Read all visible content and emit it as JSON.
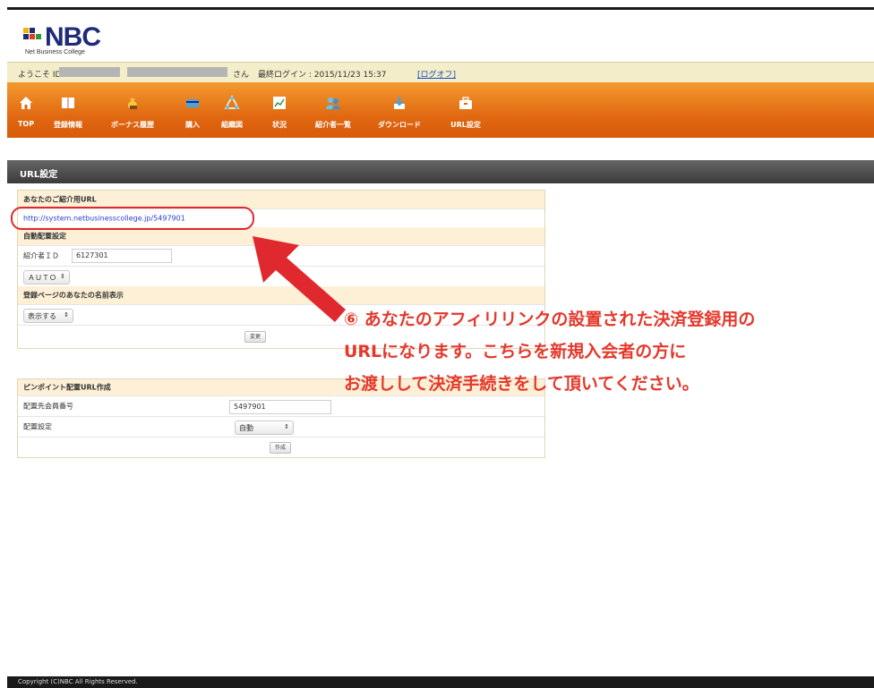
{
  "brand": {
    "logo_text": "NBC",
    "tagline": "Net Business College"
  },
  "welcome": {
    "greeting": "ようこそ ID",
    "honorific": "さん",
    "last_login_label": "最終ログイン : 2015/11/23 15:37",
    "logout_label": "[ログオフ]"
  },
  "nav": {
    "items": [
      {
        "label": "TOP",
        "icon": "home-icon"
      },
      {
        "label": "登録情報",
        "icon": "book-icon"
      },
      {
        "label": "ボーナス履歴",
        "icon": "moneybag-icon"
      },
      {
        "label": "購入",
        "icon": "card-icon"
      },
      {
        "label": "組織図",
        "icon": "org-chart-icon"
      },
      {
        "label": "状況",
        "icon": "chart-icon"
      },
      {
        "label": "紹介者一覧",
        "icon": "users-icon"
      },
      {
        "label": "ダウンロード",
        "icon": "download-icon"
      },
      {
        "label": "URL設定",
        "icon": "briefcase-icon"
      }
    ]
  },
  "section": {
    "title": "URL設定"
  },
  "panel1": {
    "header_url": "あなたのご紹介用URL",
    "affiliate_url": "http://system.netbusinesscollege.jp/5497901",
    "header_auto": "自動配置設定",
    "sponsor_label": "紹介者ＩＤ",
    "sponsor_value": "6127301",
    "auto_select": "ＡＵＴＯ",
    "header_name": "登録ページのあなたの名前表示",
    "name_select": "表示する",
    "submit_label": "変更"
  },
  "panel2": {
    "header": "ピンポイント配置URL作成",
    "member_label": "配置先会員番号",
    "member_value": "5497901",
    "place_label": "配置設定",
    "place_select": "自動",
    "create_label": "作成"
  },
  "annotation": {
    "line1": "⑥ あなたのアフィリリンクの設置された決済登録用の",
    "line2": "URLになります。こちらを新規入会者の方に",
    "line3": "お渡しして決済手続きをして頂いてください。"
  },
  "footer": {
    "copyright": "Copyright (C)NBC All Rights Reserved."
  },
  "colors": {
    "nav_orange": "#e06610",
    "annotation_red": "#e4382b",
    "brand_blue": "#1f2b78"
  }
}
